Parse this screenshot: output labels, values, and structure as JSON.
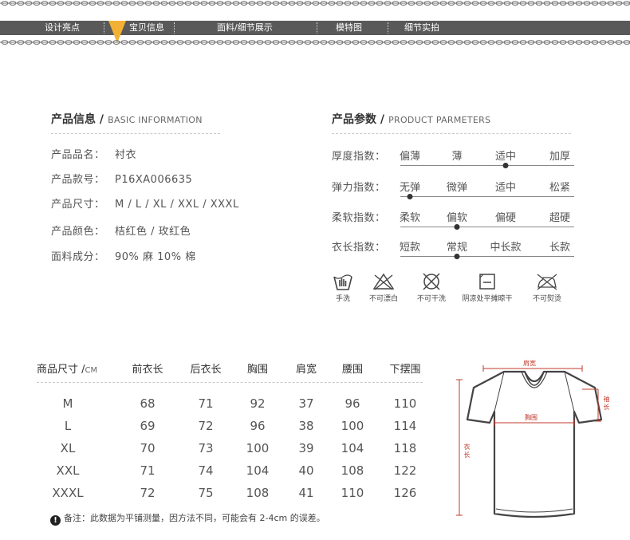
{
  "nav": {
    "items": [
      "设计亮点",
      "宝贝信息",
      "面料/细节展示",
      "模特图",
      "细节实拍"
    ],
    "active_index": 1,
    "bar_color": "#595959",
    "marker_color": "#f2b035"
  },
  "basic_info": {
    "title": "产品信息 /",
    "title_en": "BASIC INFORMATION",
    "rows": [
      {
        "label": "产品品名：",
        "value": "衬衣"
      },
      {
        "label": "产品款号：",
        "value": "P16XA006635"
      },
      {
        "label": "产品尺寸：",
        "value": "M / L / XL / XXL  / XXXL"
      },
      {
        "label": "产品颜色：",
        "value": "桔红色 / 玫红色"
      },
      {
        "label": "面料成分：",
        "value": "90% 麻 10% 棉"
      }
    ]
  },
  "product_params": {
    "title": "产品参数 /",
    "title_en": "PRODUCT PARMETERS",
    "rows": [
      {
        "label": "厚度指数：",
        "options": [
          "偏薄",
          "薄",
          "适中",
          "加厚"
        ],
        "selected": 2
      },
      {
        "label": "弹力指数：",
        "options": [
          "无弹",
          "微弹",
          "适中",
          "松紧"
        ],
        "selected": 0
      },
      {
        "label": "柔软指数：",
        "options": [
          "柔软",
          "偏软",
          "偏硬",
          "超硬"
        ],
        "selected": 1
      },
      {
        "label": "衣长指数：",
        "options": [
          "短款",
          "常规",
          "中长款",
          "长款"
        ],
        "selected": 1
      }
    ]
  },
  "care": [
    {
      "icon": "hand-wash-icon",
      "label": "手洗"
    },
    {
      "icon": "no-bleach-icon",
      "label": "不可漂白"
    },
    {
      "icon": "no-dry-clean-icon",
      "label": "不可干洗"
    },
    {
      "icon": "shade-dry-flat-icon",
      "label": "阴凉处平摊晾干"
    },
    {
      "icon": "no-iron-icon",
      "label": "不可熨烫"
    }
  ],
  "size_table": {
    "header_first": "商品尺寸 /",
    "header_unit": "CM",
    "headers": [
      "前衣长",
      "后衣长",
      "胸围",
      "肩宽",
      "腰围",
      "下摆围"
    ],
    "rows": [
      [
        "M",
        "68",
        "71",
        "92",
        "37",
        "96",
        "110"
      ],
      [
        "L",
        "69",
        "72",
        "96",
        "38",
        "100",
        "114"
      ],
      [
        "XL",
        "70",
        "73",
        "100",
        "39",
        "104",
        "118"
      ],
      [
        "XXL",
        "71",
        "74",
        "104",
        "40",
        "108",
        "122"
      ],
      [
        "XXXL",
        "72",
        "75",
        "108",
        "41",
        "110",
        "126"
      ]
    ],
    "note_icon": "!",
    "note": "备注：此数据为平铺测量，因方法不同，可能会有 2-4cm 的误差。"
  },
  "diagram": {
    "shoulder": "肩宽",
    "chest": "胸围",
    "sleeve": "袖长",
    "length": "衣长",
    "measure_color": "#c0392b"
  }
}
